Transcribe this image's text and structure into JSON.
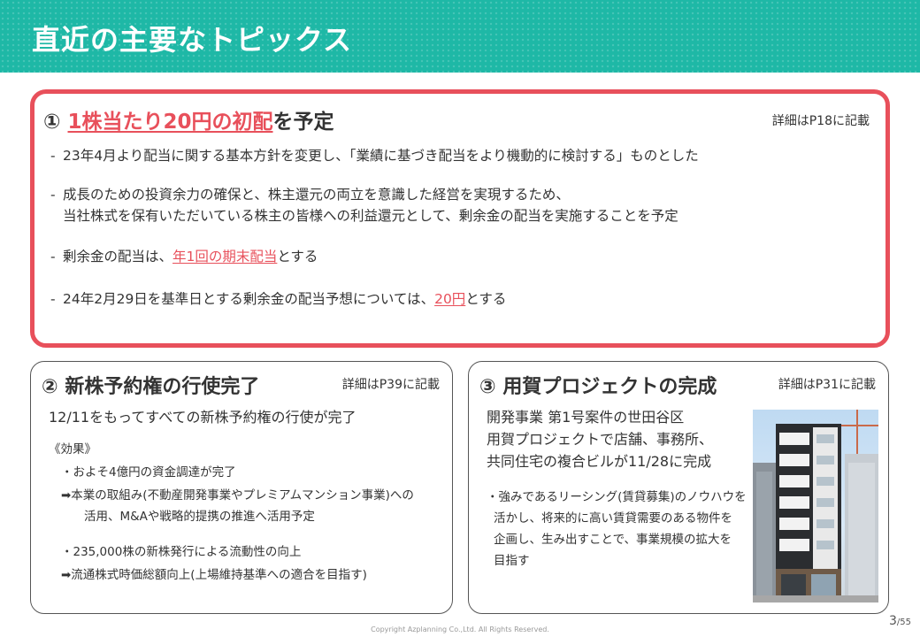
{
  "header": {
    "title": "直近の主要なトピックス"
  },
  "topic1": {
    "num": "①",
    "title_highlight": "1株当たり20円の初配",
    "title_rest": "を予定",
    "ref": "詳細はP18に記載",
    "bullets": [
      {
        "dash": "-",
        "text": "23年4月より配当に関する基本方針を変更し、「業績に基づき配当をより機動的に検討する」ものとした"
      },
      {
        "dash": "-",
        "line1": "成長のための投資余力の確保と、株主還元の両立を意識した経営を実現するため、",
        "line2": "当社株式を保有いただいている株主の皆様への利益還元として、剰余金の配当を実施することを予定"
      },
      {
        "dash": "-",
        "pre": "剰余金の配当は、",
        "hl": "年1回の期末配当",
        "post": "とする"
      },
      {
        "dash": "-",
        "pre": "24年2月29日を基準日とする剰余金の配当予想については、",
        "hl": "20円",
        "post": "とする"
      }
    ]
  },
  "topic2": {
    "num": "②",
    "title": "新株予約権の行使完了",
    "ref": "詳細はP39に記載",
    "lead": "12/11をもってすべての新株予約権の行使が完了",
    "effects_label": "《効果》",
    "effect1": "・およそ4億円の資金調達が完了",
    "effect1_arrow": "➡本業の取組み(不動産開発事業やプレミアムマンション事業)への",
    "effect1_arrow2": "活用、M&Aや戦略的提携の推進へ活用予定",
    "effect2": "・235,000株の新株発行による流動性の向上",
    "effect2_arrow": "➡流通株式時価総額向上(上場維持基準への適合を目指す)"
  },
  "topic3": {
    "num": "③",
    "title": "用賀プロジェクトの完成",
    "ref": "詳細はP31に記載",
    "lead_lines": [
      "開発事業 第1号案件の世田谷区",
      "用賀プロジェクトで店舗、事務所、",
      "共同住宅の複合ビルが11/28に完成"
    ],
    "detail_lines": [
      "・強みであるリーシング(賃貸募集)のノウハウを",
      "活かし、将来的に高い賃貸需要のある物件を",
      "企画し、生み出すことで、事業規模の拡大を",
      "目指す"
    ]
  },
  "footer": {
    "page": "3",
    "total": "/55",
    "copyright": "Copyright Azplanning Co.,Ltd. All Rights Reserved."
  },
  "colors": {
    "header_teal": "#1eb8a6",
    "accent_red": "#e8505b"
  }
}
